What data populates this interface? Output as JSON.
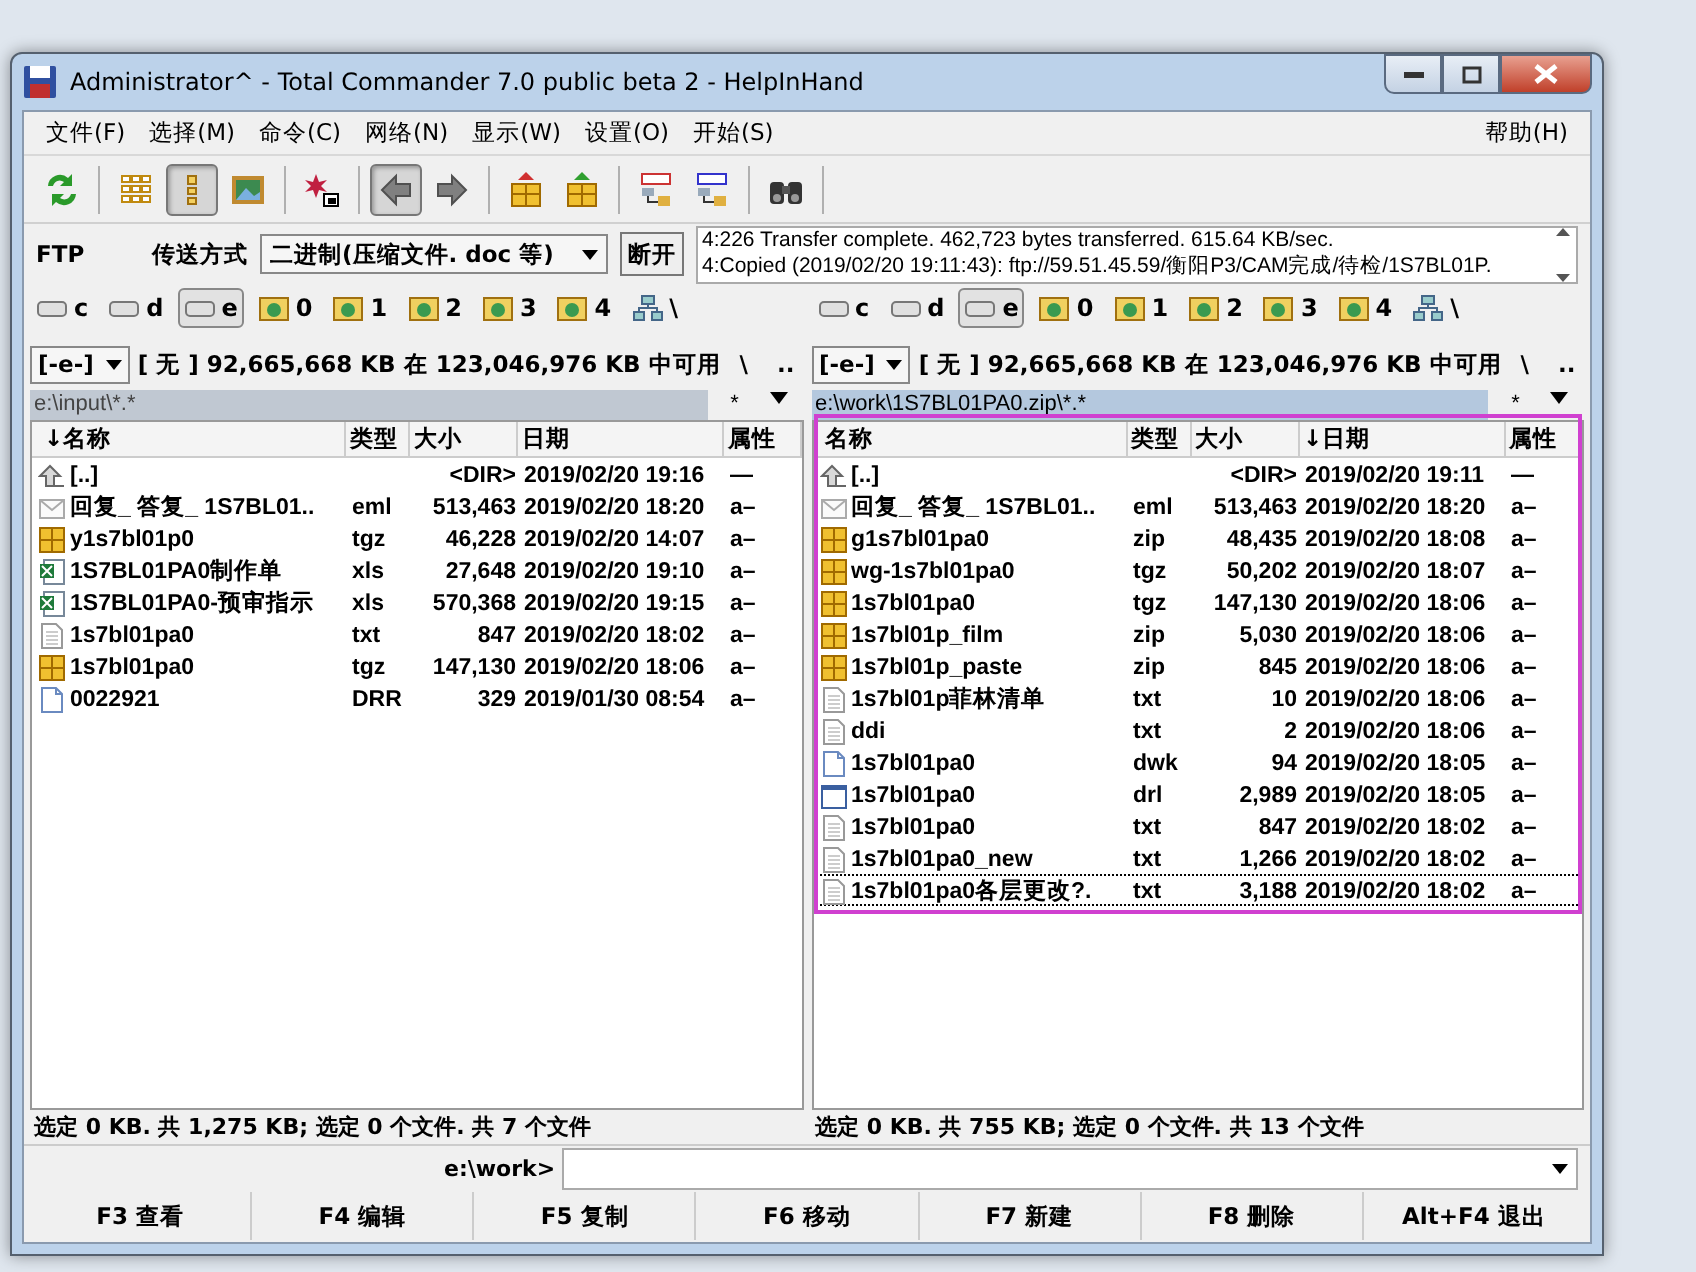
{
  "window": {
    "title": "Administrator^ - Total Commander 7.0 public beta 2 - HelpInHand"
  },
  "menu": {
    "items": [
      "文件(F)",
      "选择(M)",
      "命令(C)",
      "网络(N)",
      "显示(W)",
      "设置(O)",
      "开始(S)"
    ],
    "help": "帮助(H)"
  },
  "toolbar": [
    [
      {
        "kind": "refresh",
        "selected": false
      }
    ],
    [
      {
        "kind": "brief",
        "selected": false
      },
      {
        "kind": "detail",
        "selected": true
      },
      {
        "kind": "thumbs",
        "selected": false
      }
    ],
    [
      {
        "kind": "star",
        "selected": false
      }
    ],
    [
      {
        "kind": "back",
        "selected": true
      },
      {
        "kind": "forward",
        "selected": false
      }
    ],
    [
      {
        "kind": "pack",
        "selected": false
      },
      {
        "kind": "unpack",
        "selected": false
      }
    ],
    [
      {
        "kind": "ftp",
        "selected": false
      },
      {
        "kind": "url",
        "selected": false
      }
    ],
    [
      {
        "kind": "find",
        "selected": false
      }
    ]
  ],
  "ftp": {
    "label": "FTP",
    "mode_label": "传送方式",
    "mode": "二进制(压缩文件. doc 等)",
    "disconnect": "断开",
    "log": [
      "4:226 Transfer complete. 462,723 bytes transferred. 615.64 KB/sec.",
      "4:Copied (2019/02/20 19:11:43): ftp://59.51.45.59/衡阳P3/CAM完成/待检/1S7BL01P."
    ]
  },
  "panels": [
    {
      "drives": [
        {
          "label": "c",
          "kind": "drive",
          "selected": false
        },
        {
          "label": "d",
          "kind": "drive",
          "selected": false
        },
        {
          "label": "e",
          "kind": "drive",
          "selected": true
        },
        {
          "label": "0",
          "kind": "ftp",
          "selected": false
        },
        {
          "label": "1",
          "kind": "ftp",
          "selected": false
        },
        {
          "label": "2",
          "kind": "ftp",
          "selected": false
        },
        {
          "label": "3",
          "kind": "ftp",
          "selected": false
        },
        {
          "label": "4",
          "kind": "ftp",
          "selected": false
        },
        {
          "label": "\\",
          "kind": "network",
          "selected": false
        }
      ],
      "drive_select": "[-e-]",
      "free": "[ 无 ]  92,665,668 KB 在 123,046,976 KB 中可用",
      "root": "\\",
      "parent": "..",
      "path": "e:\\input\\*.*",
      "filter": "*",
      "active": false,
      "columns": [
        "↓名称",
        "类型",
        "大小",
        "日期",
        "属性"
      ],
      "rows": [
        {
          "kind": "up",
          "name": "[..]",
          "type": "",
          "size": "<DIR>",
          "date": "2019/02/20 19:16",
          "attr": "—",
          "selected": false
        },
        {
          "kind": "mail",
          "name": "回复_ 答复_ 1S7BL01..",
          "type": "eml",
          "size": "513,463",
          "date": "2019/02/20 18:20",
          "attr": "a–",
          "selected": false
        },
        {
          "kind": "archive",
          "name": "y1s7bl01p0",
          "type": "tgz",
          "size": "46,228",
          "date": "2019/02/20 14:07",
          "attr": "a–",
          "selected": false
        },
        {
          "kind": "sheet",
          "name": "1S7BL01PA0制作单",
          "type": "xls",
          "size": "27,648",
          "date": "2019/02/20 19:10",
          "attr": "a–",
          "selected": false
        },
        {
          "kind": "sheet",
          "name": "1S7BL01PA0-预审指示",
          "type": "xls",
          "size": "570,368",
          "date": "2019/02/20 19:15",
          "attr": "a–",
          "selected": false
        },
        {
          "kind": "text",
          "name": "1s7bl01pa0",
          "type": "txt",
          "size": "847",
          "date": "2019/02/20 18:02",
          "attr": "a–",
          "selected": false
        },
        {
          "kind": "archive",
          "name": "1s7bl01pa0",
          "type": "tgz",
          "size": "147,130",
          "date": "2019/02/20 18:06",
          "attr": "a–",
          "selected": false
        },
        {
          "kind": "file",
          "name": "0022921",
          "type": "DRR",
          "size": "329",
          "date": "2019/01/30 08:54",
          "attr": "a–",
          "selected": false
        }
      ],
      "status": "选定 0 KB. 共 1,275 KB; 选定 0 个文件. 共 7 个文件"
    },
    {
      "drives": [
        {
          "label": "c",
          "kind": "drive",
          "selected": false
        },
        {
          "label": "d",
          "kind": "drive",
          "selected": false
        },
        {
          "label": "e",
          "kind": "drive",
          "selected": true
        },
        {
          "label": "0",
          "kind": "ftp",
          "selected": false
        },
        {
          "label": "1",
          "kind": "ftp",
          "selected": false
        },
        {
          "label": "2",
          "kind": "ftp",
          "selected": false
        },
        {
          "label": "3",
          "kind": "ftp",
          "selected": false
        },
        {
          "label": "4",
          "kind": "ftp",
          "selected": false
        },
        {
          "label": "\\",
          "kind": "network",
          "selected": false
        }
      ],
      "drive_select": "[-e-]",
      "free": "[ 无 ]  92,665,668 KB 在 123,046,976 KB 中可用",
      "root": "\\",
      "parent": "..",
      "path": "e:\\work\\1S7BL01PA0.zip\\*.*",
      "filter": "*",
      "active": true,
      "columns": [
        "名称",
        "类型",
        "大小",
        "↓日期",
        "属性"
      ],
      "rows": [
        {
          "kind": "up",
          "name": "[..]",
          "type": "",
          "size": "<DIR>",
          "date": "2019/02/20 19:11",
          "attr": "—",
          "selected": false
        },
        {
          "kind": "mail",
          "name": "回复_ 答复_ 1S7BL01..",
          "type": "eml",
          "size": "513,463",
          "date": "2019/02/20 18:20",
          "attr": "a–",
          "selected": false
        },
        {
          "kind": "archive",
          "name": "g1s7bl01pa0",
          "type": "zip",
          "size": "48,435",
          "date": "2019/02/20 18:08",
          "attr": "a–",
          "selected": false
        },
        {
          "kind": "archive",
          "name": "wg-1s7bl01pa0",
          "type": "tgz",
          "size": "50,202",
          "date": "2019/02/20 18:07",
          "attr": "a–",
          "selected": false
        },
        {
          "kind": "archive",
          "name": "1s7bl01pa0",
          "type": "tgz",
          "size": "147,130",
          "date": "2019/02/20 18:06",
          "attr": "a–",
          "selected": false
        },
        {
          "kind": "archive",
          "name": "1s7bl01p_film",
          "type": "zip",
          "size": "5,030",
          "date": "2019/02/20 18:06",
          "attr": "a–",
          "selected": false
        },
        {
          "kind": "archive",
          "name": "1s7bl01p_paste",
          "type": "zip",
          "size": "845",
          "date": "2019/02/20 18:06",
          "attr": "a–",
          "selected": false
        },
        {
          "kind": "text",
          "name": "1s7bl01p菲林清单",
          "type": "txt",
          "size": "10",
          "date": "2019/02/20 18:06",
          "attr": "a–",
          "selected": false
        },
        {
          "kind": "text",
          "name": "ddi",
          "type": "txt",
          "size": "2",
          "date": "2019/02/20 18:06",
          "attr": "a–",
          "selected": false
        },
        {
          "kind": "file",
          "name": "1s7bl01pa0",
          "type": "dwk",
          "size": "94",
          "date": "2019/02/20 18:05",
          "attr": "a–",
          "selected": false
        },
        {
          "kind": "window",
          "name": "1s7bl01pa0",
          "type": "drl",
          "size": "2,989",
          "date": "2019/02/20 18:05",
          "attr": "a–",
          "selected": false
        },
        {
          "kind": "text",
          "name": "1s7bl01pa0",
          "type": "txt",
          "size": "847",
          "date": "2019/02/20 18:02",
          "attr": "a–",
          "selected": false
        },
        {
          "kind": "text",
          "name": "1s7bl01pa0_new",
          "type": "txt",
          "size": "1,266",
          "date": "2019/02/20 18:02",
          "attr": "a–",
          "selected": false
        },
        {
          "kind": "text",
          "name": "1s7bl01pa0各层更改?.",
          "type": "txt",
          "size": "3,188",
          "date": "2019/02/20 18:02",
          "attr": "a–",
          "selected": true
        }
      ],
      "status": "选定 0 KB. 共 755 KB; 选定 0 个文件. 共 13 个文件"
    }
  ],
  "command_line": {
    "prompt": "e:\\work>"
  },
  "function_keys": [
    "F3 查看",
    "F4 编辑",
    "F5 复制",
    "F6 移动",
    "F7 新建",
    "F8 删除",
    "Alt+F4 退出"
  ]
}
